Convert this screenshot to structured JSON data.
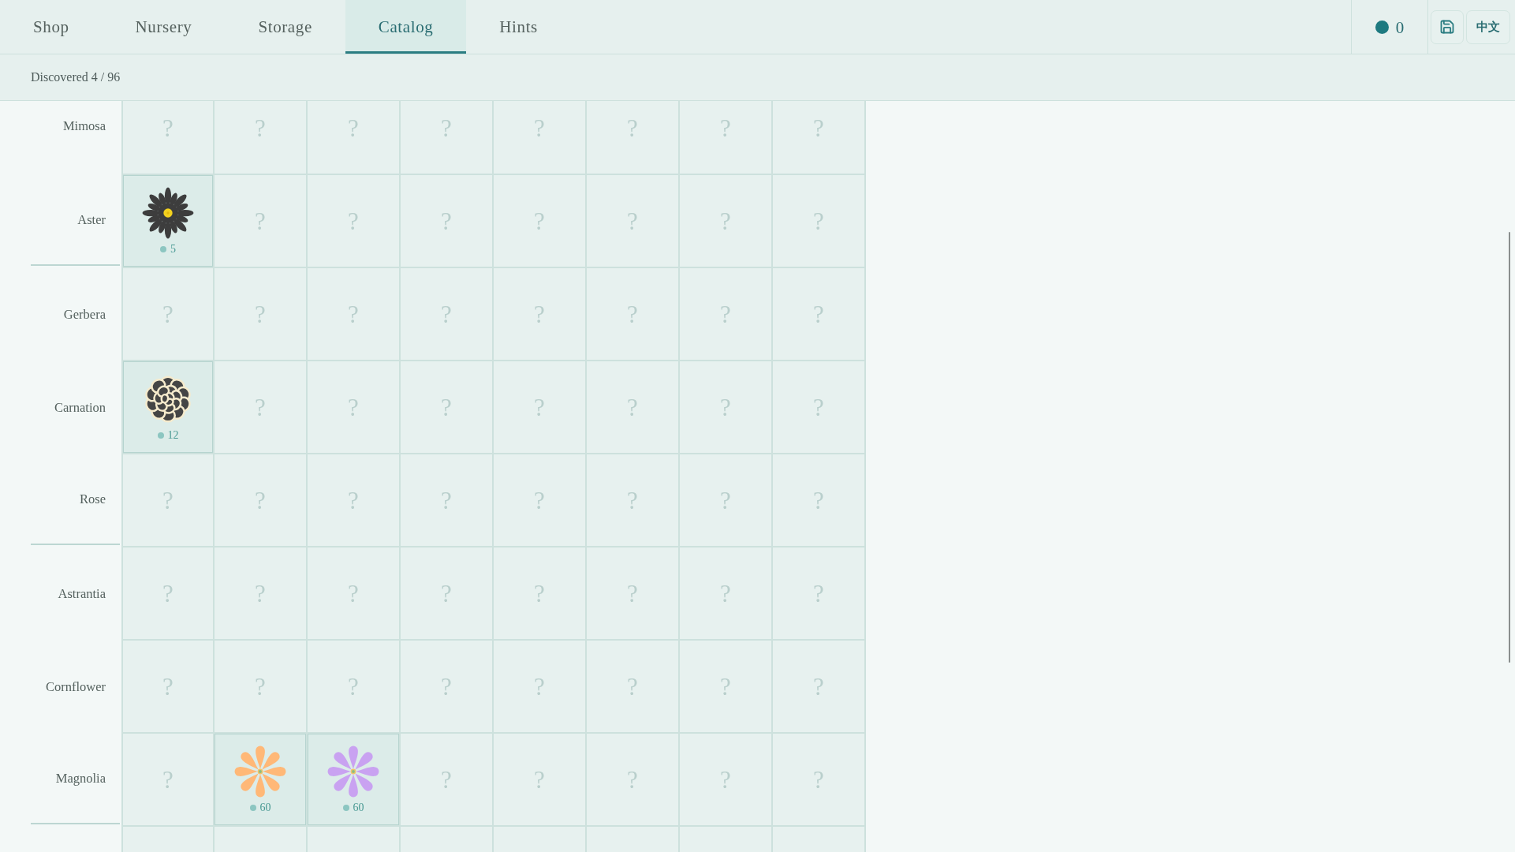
{
  "tabs": [
    {
      "label": "Shop",
      "selected": false
    },
    {
      "label": "Nursery",
      "selected": false
    },
    {
      "label": "Storage",
      "selected": false
    },
    {
      "label": "Catalog",
      "selected": true
    },
    {
      "label": "Hints",
      "selected": false
    }
  ],
  "coins": {
    "amount": "0"
  },
  "actions": [
    {
      "kind": "save"
    },
    {
      "kind": "language",
      "label": "中文"
    }
  ],
  "progress_text": "Discovered 4 / 96",
  "catalog": {
    "groups": [
      {
        "rows": [
          {
            "name": "Mimosa",
            "cells": [
              {
                "discovered": false,
                "text": "?"
              },
              {
                "discovered": false,
                "text": "?"
              },
              {
                "discovered": false,
                "text": "?"
              },
              {
                "discovered": false,
                "text": "?"
              },
              {
                "discovered": false,
                "text": "?"
              },
              {
                "discovered": false,
                "text": "?"
              },
              {
                "discovered": false,
                "text": "?"
              },
              {
                "discovered": false,
                "text": "?"
              }
            ]
          },
          {
            "name": "Aster",
            "cells": [
              {
                "discovered": true,
                "kind": "daisy",
                "color": "#3d3d3d",
                "price": "5"
              },
              {
                "discovered": false,
                "text": "?"
              },
              {
                "discovered": false,
                "text": "?"
              },
              {
                "discovered": false,
                "text": "?"
              },
              {
                "discovered": false,
                "text": "?"
              },
              {
                "discovered": false,
                "text": "?"
              },
              {
                "discovered": false,
                "text": "?"
              },
              {
                "discovered": false,
                "text": "?"
              }
            ]
          }
        ]
      },
      {
        "rows": [
          {
            "name": "Gerbera",
            "cells": [
              {
                "discovered": false,
                "text": "?"
              },
              {
                "discovered": false,
                "text": "?"
              },
              {
                "discovered": false,
                "text": "?"
              },
              {
                "discovered": false,
                "text": "?"
              },
              {
                "discovered": false,
                "text": "?"
              },
              {
                "discovered": false,
                "text": "?"
              },
              {
                "discovered": false,
                "text": "?"
              },
              {
                "discovered": false,
                "text": "?"
              }
            ]
          },
          {
            "name": "Carnation",
            "cells": [
              {
                "discovered": true,
                "kind": "ruffled",
                "color": "#454545",
                "price": "12"
              },
              {
                "discovered": false,
                "text": "?"
              },
              {
                "discovered": false,
                "text": "?"
              },
              {
                "discovered": false,
                "text": "?"
              },
              {
                "discovered": false,
                "text": "?"
              },
              {
                "discovered": false,
                "text": "?"
              },
              {
                "discovered": false,
                "text": "?"
              },
              {
                "discovered": false,
                "text": "?"
              }
            ]
          },
          {
            "name": "Rose",
            "cells": [
              {
                "discovered": false,
                "text": "?"
              },
              {
                "discovered": false,
                "text": "?"
              },
              {
                "discovered": false,
                "text": "?"
              },
              {
                "discovered": false,
                "text": "?"
              },
              {
                "discovered": false,
                "text": "?"
              },
              {
                "discovered": false,
                "text": "?"
              },
              {
                "discovered": false,
                "text": "?"
              },
              {
                "discovered": false,
                "text": "?"
              }
            ]
          }
        ]
      },
      {
        "rows": [
          {
            "name": "Astrantia",
            "cells": [
              {
                "discovered": false,
                "text": "?"
              },
              {
                "discovered": false,
                "text": "?"
              },
              {
                "discovered": false,
                "text": "?"
              },
              {
                "discovered": false,
                "text": "?"
              },
              {
                "discovered": false,
                "text": "?"
              },
              {
                "discovered": false,
                "text": "?"
              },
              {
                "discovered": false,
                "text": "?"
              },
              {
                "discovered": false,
                "text": "?"
              }
            ]
          },
          {
            "name": "Cornflower",
            "cells": [
              {
                "discovered": false,
                "text": "?"
              },
              {
                "discovered": false,
                "text": "?"
              },
              {
                "discovered": false,
                "text": "?"
              },
              {
                "discovered": false,
                "text": "?"
              },
              {
                "discovered": false,
                "text": "?"
              },
              {
                "discovered": false,
                "text": "?"
              },
              {
                "discovered": false,
                "text": "?"
              },
              {
                "discovered": false,
                "text": "?"
              }
            ]
          },
          {
            "name": "Magnolia",
            "cells": [
              {
                "discovered": false,
                "text": "?"
              },
              {
                "discovered": true,
                "kind": "star",
                "color": "#ffb877",
                "price": "60"
              },
              {
                "discovered": true,
                "kind": "star",
                "color": "#c9a2f1",
                "price": "60"
              },
              {
                "discovered": false,
                "text": "?"
              },
              {
                "discovered": false,
                "text": "?"
              },
              {
                "discovered": false,
                "text": "?"
              },
              {
                "discovered": false,
                "text": "?"
              },
              {
                "discovered": false,
                "text": "?"
              }
            ]
          }
        ]
      }
    ]
  }
}
